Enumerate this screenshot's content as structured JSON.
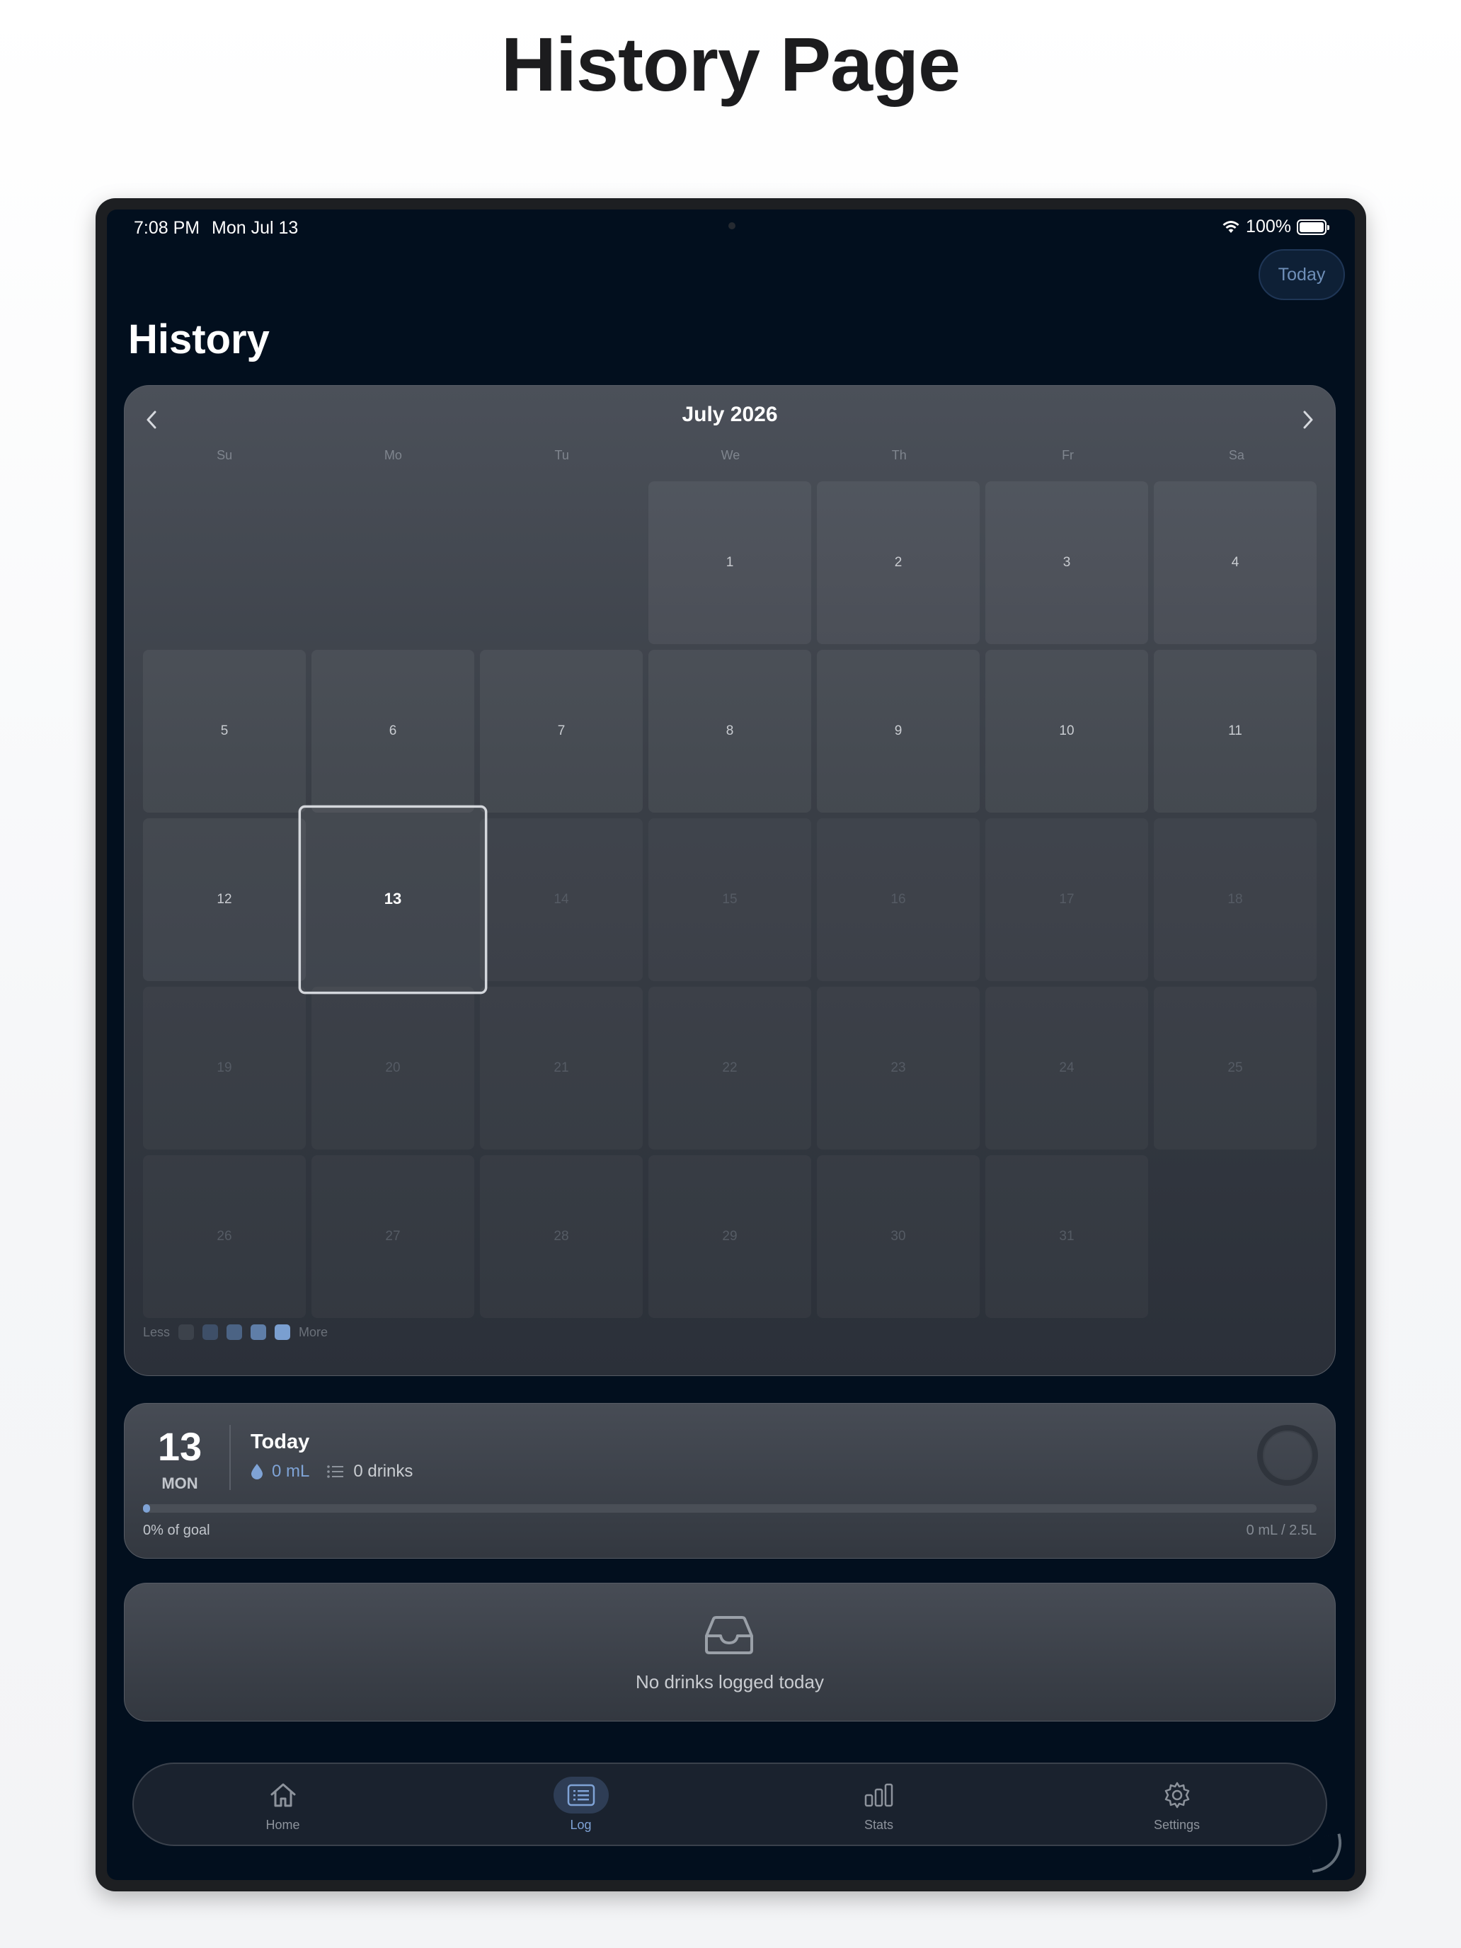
{
  "page_heading": "History Page",
  "status_bar": {
    "time": "7:08 PM",
    "date": "Mon Jul 13",
    "battery": "100%"
  },
  "header": {
    "today_button": "Today",
    "title": "History"
  },
  "calendar": {
    "month_label": "July 2026",
    "weekdays": [
      "Su",
      "Mo",
      "Tu",
      "We",
      "Th",
      "Fr",
      "Sa"
    ],
    "leading_blanks": 3,
    "days": [
      "1",
      "2",
      "3",
      "4",
      "5",
      "6",
      "7",
      "8",
      "9",
      "10",
      "11",
      "12",
      "13",
      "14",
      "15",
      "16",
      "17",
      "18",
      "19",
      "20",
      "21",
      "22",
      "23",
      "24",
      "25",
      "26",
      "27",
      "28",
      "29",
      "30",
      "31"
    ],
    "selected_day": "13",
    "legend": {
      "less": "Less",
      "more": "More",
      "colors": [
        "#3c424b",
        "#3e4f68",
        "#4b6384",
        "#5f7ea8",
        "#7a9fd0"
      ]
    }
  },
  "day_summary": {
    "day_number": "13",
    "weekday": "MON",
    "title": "Today",
    "volume": "0 mL",
    "drinks": "0 drinks",
    "progress_fraction": 0,
    "percent_text": "0% of goal",
    "total_text": "0 mL / 2.5L"
  },
  "empty_state": {
    "message": "No drinks logged today",
    "icon": "inbox-icon"
  },
  "tabbar": {
    "items": [
      {
        "label": "Home",
        "icon": "home-icon"
      },
      {
        "label": "Log",
        "icon": "list-icon",
        "active": true
      },
      {
        "label": "Stats",
        "icon": "bar-chart-icon"
      },
      {
        "label": "Settings",
        "icon": "gear-icon"
      }
    ]
  },
  "colors": {
    "accent": "#7fa3d6",
    "background": "#020f1e",
    "card": "#3f444c"
  }
}
